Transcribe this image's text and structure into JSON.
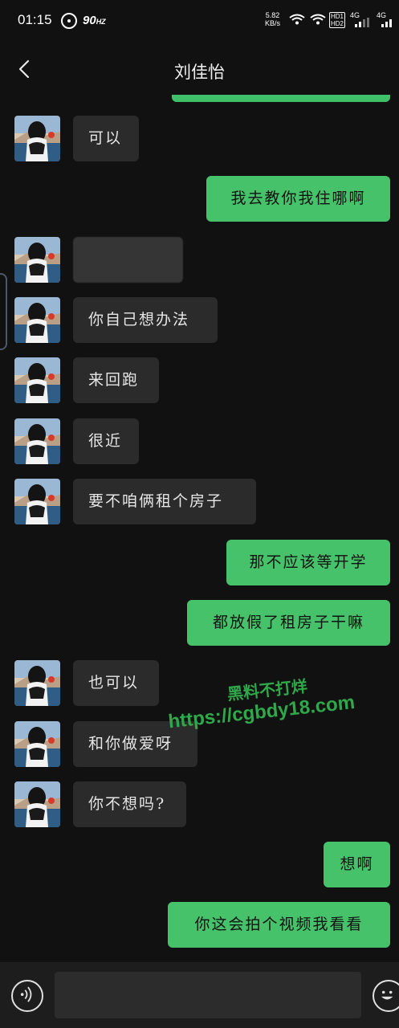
{
  "status_bar": {
    "time": "01:15",
    "refresh_rate": "90",
    "refresh_unit": "HZ",
    "net_speed_value": "5.82",
    "net_speed_unit": "KB/s",
    "hd_badge_1": "HD1",
    "hd_badge_2": "HD2",
    "signal_1_label": "4G",
    "signal_2_label": "4G"
  },
  "header": {
    "title": "刘佳怡"
  },
  "messages": [
    {
      "side": "in",
      "text": "可以"
    },
    {
      "side": "out",
      "text": "我去教你我住哪啊"
    },
    {
      "side": "in",
      "text": "",
      "blurred": true
    },
    {
      "side": "in",
      "text": "你自己想办法"
    },
    {
      "side": "in",
      "text": "来回跑"
    },
    {
      "side": "in",
      "text": "很近"
    },
    {
      "side": "in",
      "text": "要不咱俩租个房子"
    },
    {
      "side": "out",
      "text": "那不应该等开学"
    },
    {
      "side": "out",
      "text": "都放假了租房子干嘛"
    },
    {
      "side": "in",
      "text": "也可以"
    },
    {
      "side": "in",
      "text": "和你做爱呀"
    },
    {
      "side": "in",
      "text": "你不想吗?"
    },
    {
      "side": "out",
      "text": "想啊"
    },
    {
      "side": "out",
      "text": "你这会拍个视频我看看"
    }
  ],
  "watermark": {
    "line1": "黑料不打烊",
    "line2": "https://cgbdy18.com"
  },
  "input": {
    "value": "",
    "placeholder": ""
  },
  "icons": {
    "back": "chevron-left-icon",
    "voice": "voice-icon",
    "emoji": "emoji-icon"
  },
  "colors": {
    "background": "#111111",
    "incoming_bubble": "#2b2b2b",
    "outgoing_bubble": "#45c26a",
    "watermark": "#2fa84a"
  }
}
